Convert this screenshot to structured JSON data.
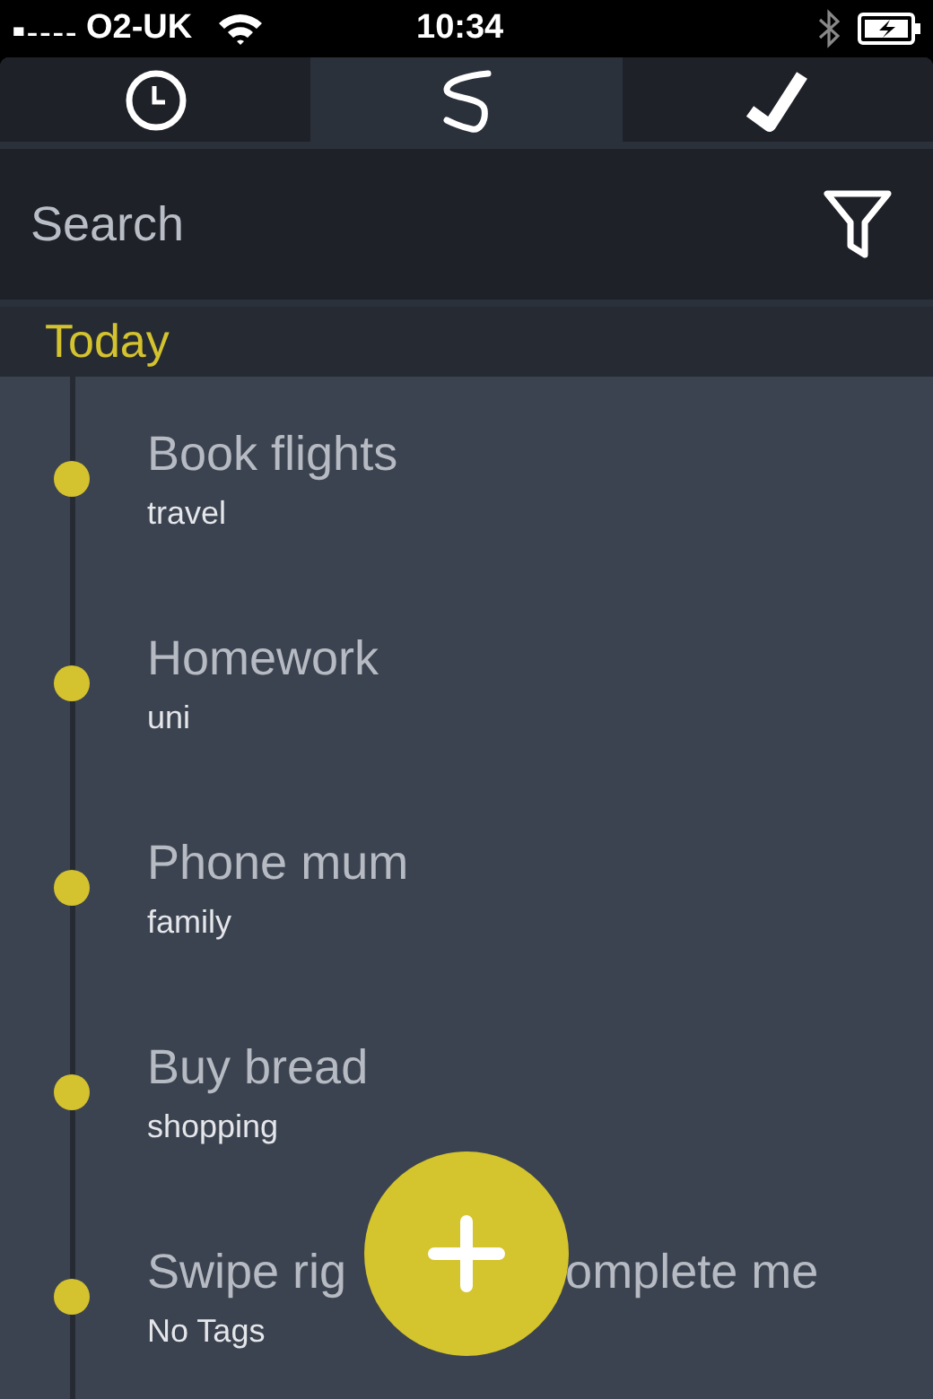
{
  "status_bar": {
    "carrier": "O2-UK",
    "time": "10:34"
  },
  "tabs": [
    {
      "kind": "clock",
      "selected": false
    },
    {
      "kind": "squiggle",
      "selected": true
    },
    {
      "kind": "check",
      "selected": false
    }
  ],
  "search": {
    "placeholder": "Search"
  },
  "section": {
    "title": "Today"
  },
  "tasks": [
    {
      "title_fragments": [
        "Book flights"
      ],
      "tag": "travel"
    },
    {
      "title_fragments": [
        "Homework"
      ],
      "tag": "uni"
    },
    {
      "title_fragments": [
        "Phone mum"
      ],
      "tag": "family"
    },
    {
      "title_fragments": [
        "Buy bread"
      ],
      "tag": "shopping"
    },
    {
      "title_fragments": [
        "Swipe rig",
        "omplete me"
      ],
      "tag": "No Tags"
    }
  ]
}
